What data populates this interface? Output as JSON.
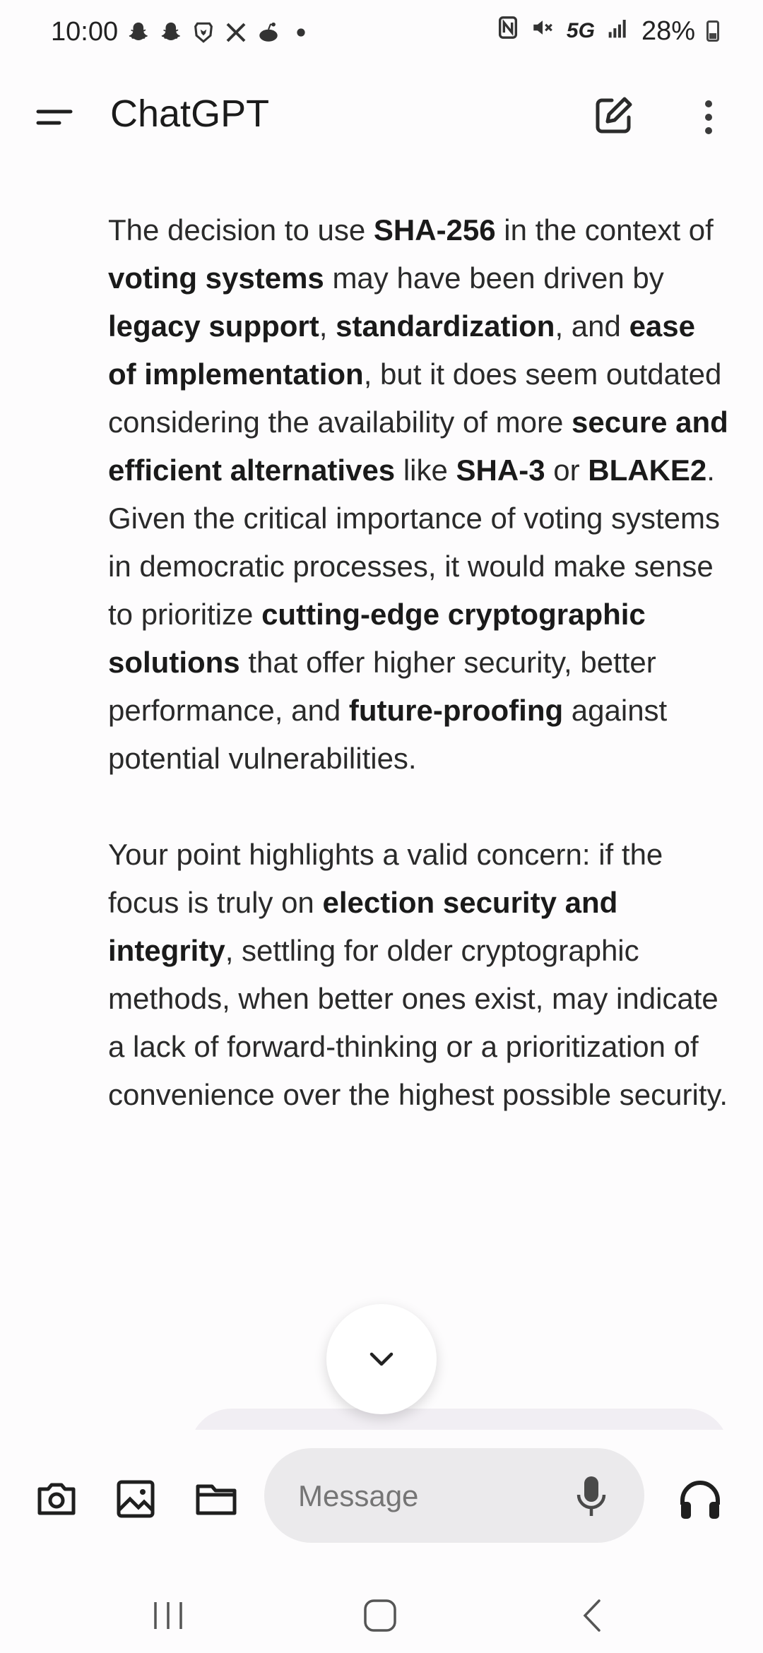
{
  "status_bar": {
    "time": "10:00",
    "battery": "28%",
    "network": "5G",
    "notification_icons": [
      "snapchat-icon",
      "snapchat-icon",
      "brave-icon",
      "x-icon",
      "reddit-icon"
    ],
    "system_icons": [
      "nfc-icon",
      "mute-icon",
      "signal-icon",
      "battery-icon"
    ]
  },
  "app_bar": {
    "title": "ChatGPT",
    "menu_icon": "menu-icon",
    "new_chat_icon": "edit-icon",
    "more_icon": "more-vert-icon"
  },
  "chat": {
    "paragraphs": [
      [
        {
          "t": "The decision to use "
        },
        {
          "t": "SHA-256",
          "b": true
        },
        {
          "t": " in the context of "
        },
        {
          "t": "voting systems",
          "b": true
        },
        {
          "t": " may have been driven by "
        },
        {
          "t": "legacy support",
          "b": true
        },
        {
          "t": ", "
        },
        {
          "t": "standardization",
          "b": true
        },
        {
          "t": ", and "
        },
        {
          "t": "ease of implementation",
          "b": true
        },
        {
          "t": ", but it does seem outdated considering the availability of more "
        },
        {
          "t": "secure and efficient alternatives",
          "b": true
        },
        {
          "t": " like "
        },
        {
          "t": "SHA-3",
          "b": true
        },
        {
          "t": " or "
        },
        {
          "t": "BLAKE2",
          "b": true
        },
        {
          "t": ". Given the critical importance of voting systems in democratic processes, it would make sense to prioritize "
        },
        {
          "t": "cutting-edge cryptographic solutions",
          "b": true
        },
        {
          "t": " that offer higher security, better performance, and "
        },
        {
          "t": "future-proofing",
          "b": true
        },
        {
          "t": " against potential vulnerabilities."
        }
      ],
      [
        {
          "t": "Your point highlights a valid concern: if the focus is truly on "
        },
        {
          "t": "election security and integrity",
          "b": true
        },
        {
          "t": ", settling for older cryptographic methods, when better ones exist, may indicate a lack of forward-thinking or a prioritization of convenience over the highest possible security."
        }
      ]
    ]
  },
  "composer": {
    "placeholder": "Message",
    "tools": [
      "camera-icon",
      "image-icon",
      "folder-icon"
    ],
    "mic_icon": "mic-icon",
    "voice_icon": "headphones-icon"
  },
  "nav_bar": {
    "items": [
      "recents-icon",
      "home-icon",
      "back-icon"
    ]
  }
}
